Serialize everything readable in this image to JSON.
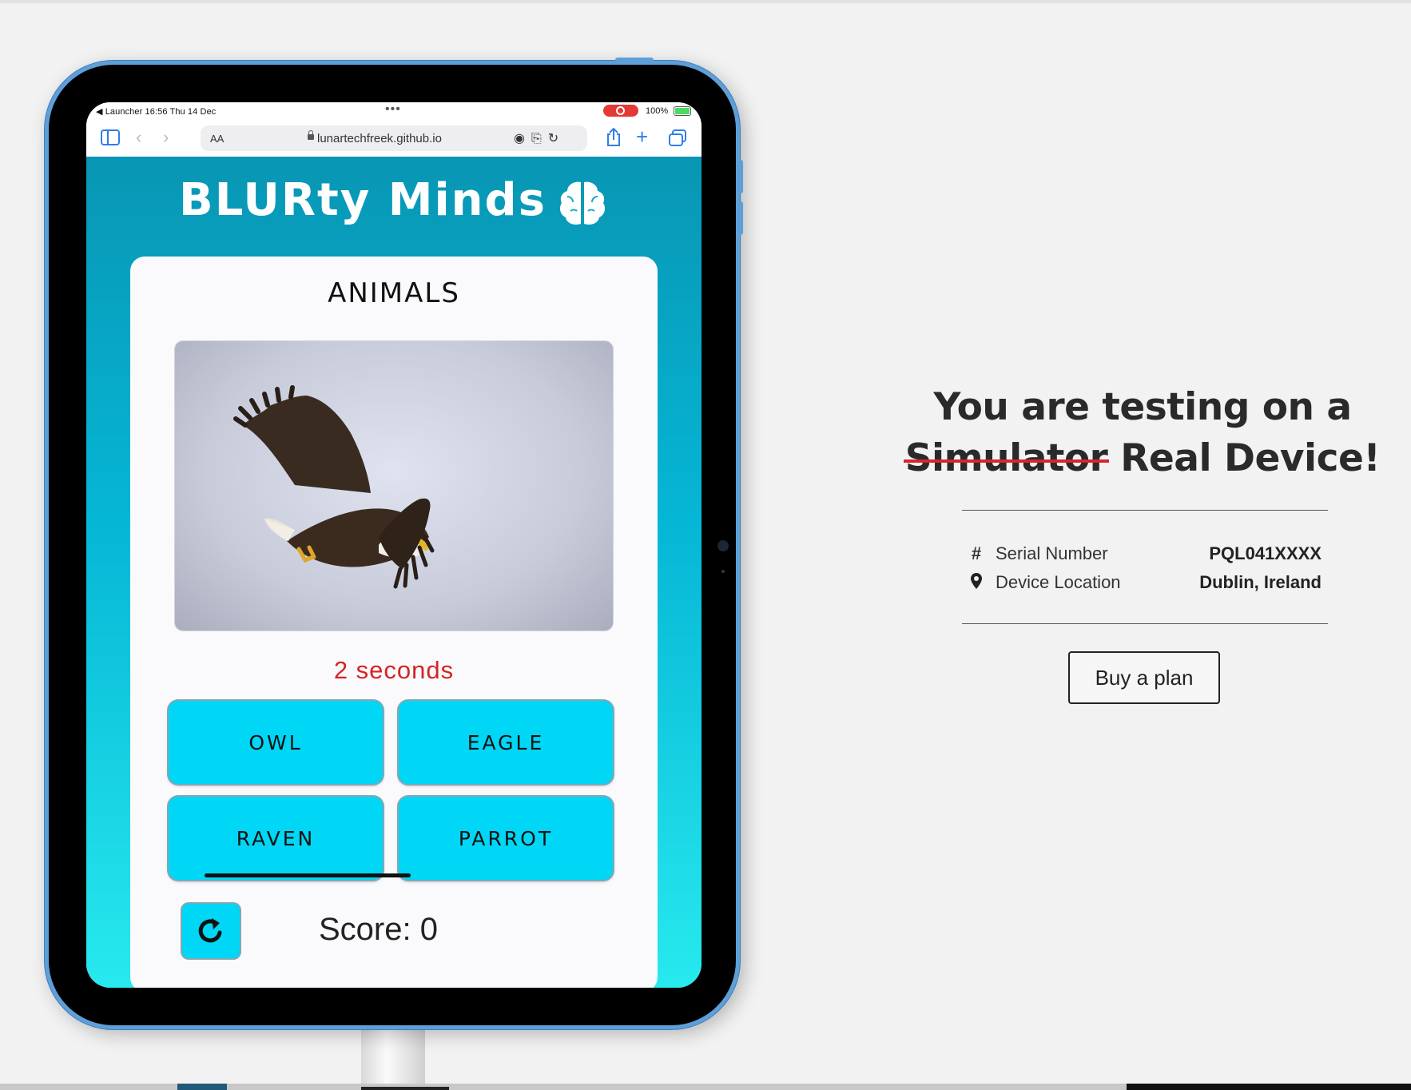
{
  "safari": {
    "status_left": "◀ Launcher   16:56   Thu 14 Dec",
    "status_dots": "•••",
    "battery": "100%",
    "text_size": "AA",
    "url": "lunartechfreek.github.io"
  },
  "app": {
    "brand": "BLURty Minds",
    "category": "ANIMALS",
    "timer": "2 seconds",
    "answers": [
      "OWL",
      "EAGLE",
      "RAVEN",
      "PARROT"
    ],
    "score": "Score: 0"
  },
  "panel": {
    "heading_line1": "You are testing on a",
    "heading_strike": "Simulator",
    "heading_line2_rest": "Real Device!",
    "serial_label": "Serial Number",
    "serial_value": "PQL041XXXX",
    "location_label": "Device Location",
    "location_value": "Dublin, Ireland",
    "buy_label": "Buy a plan"
  },
  "colors": {
    "accent_cyan": "#00d6f5",
    "timer_red": "#d52424",
    "strike_red": "#d6262a",
    "ipad_frame": "#5e9fd8"
  },
  "icons": [
    "sidebar-icon",
    "back-icon",
    "forward-icon",
    "lock-icon",
    "reload-icon",
    "share-icon",
    "new-tab-icon",
    "tabs-icon",
    "brain-icon",
    "refresh-icon",
    "hash-icon",
    "location-pin-icon"
  ]
}
